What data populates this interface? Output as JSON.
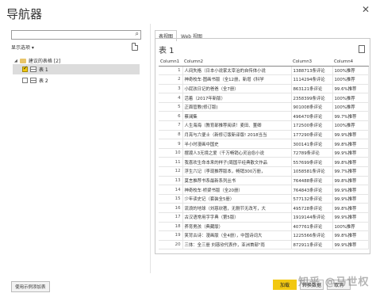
{
  "window": {
    "title": "导航器",
    "close_glyph": "✕"
  },
  "navigator": {
    "search_placeholder": "",
    "display_options_label": "显示选项 ▾",
    "folder_label": "建议的表格 [2]",
    "items": [
      {
        "label": "表 1",
        "checked": true,
        "selected": true
      },
      {
        "label": "表 2",
        "checked": false,
        "selected": false
      }
    ],
    "sample_button_label": "使用示例添加表"
  },
  "preview": {
    "tabs": [
      {
        "label": "表视图"
      },
      {
        "label": "Web 视图"
      }
    ],
    "title": "表 1",
    "columns": [
      "Column1",
      "Column2",
      "Column3",
      "Column4"
    ],
    "rows": [
      [
        "1",
        "人间失格（日本小说家太宰治的自传体小说",
        "1388713条评论",
        "100%推荐"
      ],
      [
        "2",
        "神奇校车·图画书版（全12册，新增《科学",
        "1114294条评论",
        "100%推荐"
      ],
      [
        "3",
        "小屁孩日记的爸爸（全7册）",
        "863121条评论",
        "99.6%推荐"
      ],
      [
        "4",
        "活着（2017年新版）",
        "2358399条评论",
        "100%推荐"
      ],
      [
        "5",
        "正面管教(修订版)",
        "901008条评论",
        "100%推荐"
      ],
      [
        "6",
        "蔡澜集",
        "496470条评论",
        "99.7%推荐"
      ],
      [
        "7",
        "人生海海（教育部推荐阅读！麦田、董卿",
        "172500条评论",
        "100%推荐"
      ],
      [
        "8",
        "月亮与六便士（新修订版新译版! 2018当当",
        "177290条评论",
        "99.9%推荐"
      ],
      [
        "9",
        "半小时漫画中国史",
        "300141条评论",
        "99.8%推荐"
      ],
      [
        "10",
        "摆渡人3无境之爱（千万畅销心灵治愈小说",
        "72789条评论",
        "99.9%推荐"
      ],
      [
        "11",
        "我喜欢生命本来的样子(周国平经典散文作品",
        "557699条评论",
        "99.8%推荐"
      ],
      [
        "12",
        "浮生六记（李现推荐版本，畅销300万册，",
        "1058581条评论",
        "99.7%推荐"
      ],
      [
        "13",
        "莫言推荐书系最新系列丛书",
        "764488条评论",
        "99.8%推荐"
      ],
      [
        "14",
        "神奇校车·桥梁书版（全20册）",
        "764843条评论",
        "99.9%推荐"
      ],
      [
        "15",
        "少年读史记（套装全5册）",
        "577132条评论",
        "99.9%推荐"
      ],
      [
        "16",
        "流浪的地球（刘慈欣著，无删节无改写，大",
        "495728条评论",
        "99.8%推荐"
      ],
      [
        "17",
        "古汉语常用字字典（第5版）",
        "1919144条评论",
        "99.9%推荐"
      ],
      [
        "18",
        "养育男孩（典藏版）",
        "407761条评论",
        "100%推荐"
      ],
      [
        "19",
        "笑背古诗：漫画版（全4册），中国诗词大",
        "1225566条评论",
        "99.8%推荐"
      ],
      [
        "20",
        "三体：全三册 刘慈欣代表作，亚洲首部\"雨",
        "872911条评论",
        "99.9%推荐"
      ]
    ]
  },
  "footer": {
    "load_label": "加载",
    "edit_label": "转换数据",
    "cancel_label": "取消"
  },
  "watermark": "知乎 @马世权",
  "colors": {
    "accent": "#f2c811",
    "selected_row": "#dcdcdc"
  }
}
